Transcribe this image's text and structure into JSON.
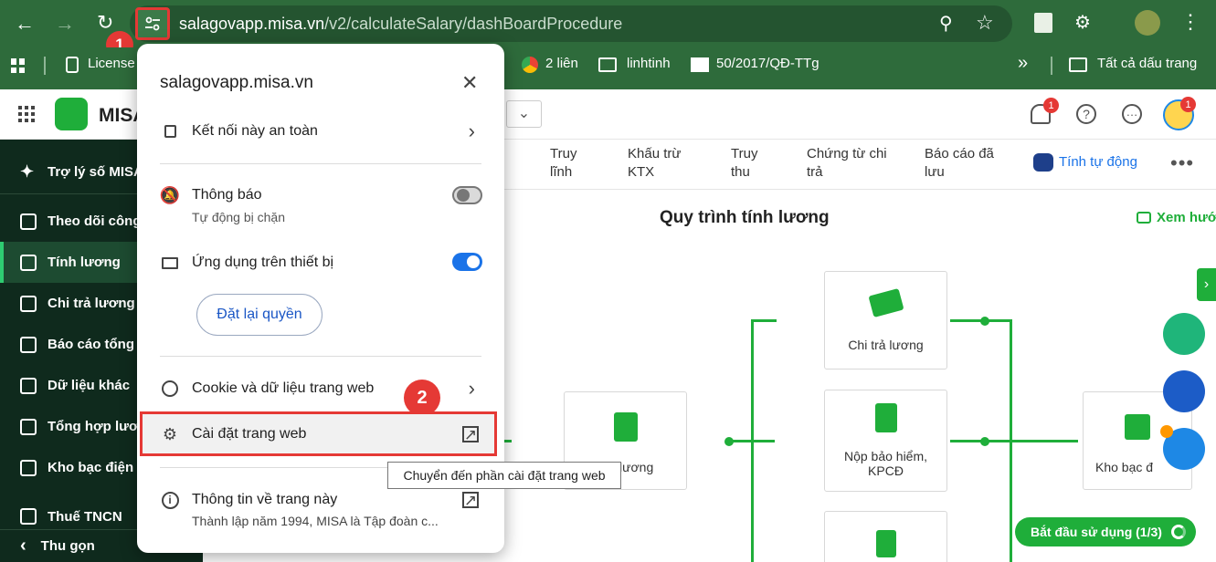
{
  "browser": {
    "url_domain": "salagovapp.misa.vn",
    "url_path": "/v2/calculateSalary/dashBoardProcedure",
    "bookmarks": [
      "License",
      "2 liên",
      "linhtinh",
      "50/2017/QĐ-TTg",
      "Tất cả dấu trang"
    ]
  },
  "app": {
    "brand": "MISA",
    "sidebar": {
      "items": [
        {
          "label": "Trợ lý số MISA"
        },
        {
          "label": "Theo dõi công"
        },
        {
          "label": "Tính lương"
        },
        {
          "label": "Chi trả lương"
        },
        {
          "label": "Báo cáo tổng h"
        },
        {
          "label": "Dữ liệu khác"
        },
        {
          "label": "Tổng hợp lương"
        },
        {
          "label": "Kho bạc điện tử"
        },
        {
          "label": "Thuế TNCN"
        }
      ],
      "collapse_label": "Thu gọn"
    },
    "tabs": [
      {
        "line1": "Truy",
        "line2": "lĩnh"
      },
      {
        "line1": "Khấu trừ",
        "line2": "KTX"
      },
      {
        "line1": "Truy",
        "line2": "thu"
      },
      {
        "line1": "Chứng từ chi",
        "line2": "trả"
      },
      {
        "line1": "Báo cáo đã",
        "line2": "lưu"
      }
    ],
    "auto_calc_label": "Tính tự động",
    "page_title": "Quy trình tính lương",
    "video_link": "Xem hướ",
    "notification_count": "1",
    "avatar_count": "1",
    "flow_cards": {
      "payroll_partial": "lương",
      "pay_salary": "Chi trả lương",
      "insurance_line1": "Nộp bảo hiểm,",
      "insurance_line2": "KPCĐ",
      "treasury_partial": "Kho bạc đ"
    },
    "start_button": "Bắt đầu sử dụng (1/3)"
  },
  "site_info_popup": {
    "title": "salagovapp.misa.vn",
    "secure_label": "Kết nối này an toàn",
    "notifications_label": "Thông báo",
    "notifications_sub": "Tự động bị chặn",
    "notifications_enabled": false,
    "device_apps_label": "Ứng dụng trên thiết bị",
    "device_apps_enabled": true,
    "reset_button": "Đặt lại quyền",
    "cookies_label": "Cookie và dữ liệu trang web",
    "site_settings_label": "Cài đặt trang web",
    "about_label": "Thông tin về trang này",
    "about_sub": "Thành lập năm 1994, MISA là Tập đoàn c..."
  },
  "tooltip": "Chuyển đến phần cài đặt trang web",
  "annotations": {
    "step1": "1",
    "step2": "2"
  },
  "colors": {
    "accent_green": "#1fae3a",
    "toggle_on": "#1a73e8",
    "highlight_red": "#e53935"
  }
}
